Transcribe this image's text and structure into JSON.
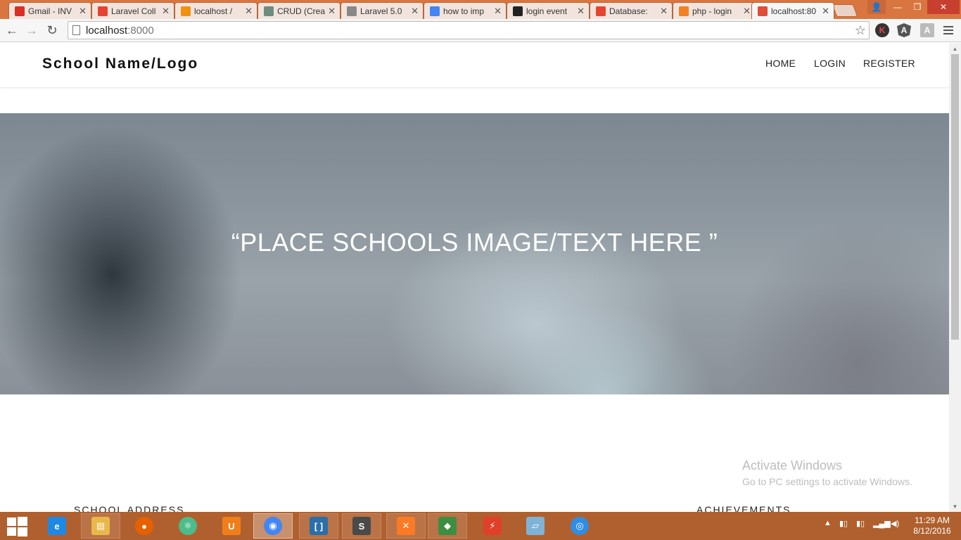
{
  "browser": {
    "tabs": [
      {
        "title": "Gmail - INV",
        "icon": "gmail-icon",
        "color": "#d93025"
      },
      {
        "title": "Laravel Coll",
        "icon": "laravel-icon",
        "color": "#e74430"
      },
      {
        "title": "localhost /",
        "icon": "phpmyadmin-icon",
        "color": "#f29111"
      },
      {
        "title": "CRUD (Crea",
        "icon": "code-icon",
        "color": "#6d8c7e"
      },
      {
        "title": "Laravel 5.0",
        "icon": "document-icon",
        "color": "#888888"
      },
      {
        "title": "how to imp",
        "icon": "google-icon",
        "color": "#4285f4"
      },
      {
        "title": "login event",
        "icon": "github-icon",
        "color": "#222222"
      },
      {
        "title": "Database: ",
        "icon": "laravel-icon",
        "color": "#e74430"
      },
      {
        "title": "php - login",
        "icon": "stackoverflow-icon",
        "color": "#f48024"
      },
      {
        "title": "localhost:80",
        "icon": "app-triangle-icon",
        "color": "#e04e39"
      }
    ],
    "close_glyph": "✕",
    "address": {
      "host": "localhost",
      "port": ":8000"
    }
  },
  "site": {
    "brand": "School Name/Logo",
    "nav": [
      "HOME",
      "LOGIN",
      "REGISTER"
    ],
    "hero_text": "“PLACE SCHOOLS IMAGE/TEXT HERE ”",
    "section_left": "SCHOOL ADDRESS",
    "section_right": "ACHIEVEMENTS"
  },
  "watermark": {
    "line1": "Activate Windows",
    "line2": "Go to PC settings to activate Windows."
  },
  "taskbar": {
    "apps": [
      "internet-explorer-icon",
      "file-explorer-icon",
      "firefox-icon",
      "atom-icon",
      "uc-browser-icon",
      "chrome-icon",
      "brackets-icon",
      "sublime-text-icon",
      "xampp-icon",
      "git-gui-icon",
      "filezilla-icon",
      "notepad-icon",
      "misc-app-icon"
    ],
    "time": "11:29 AM",
    "date": "8/12/2016"
  }
}
